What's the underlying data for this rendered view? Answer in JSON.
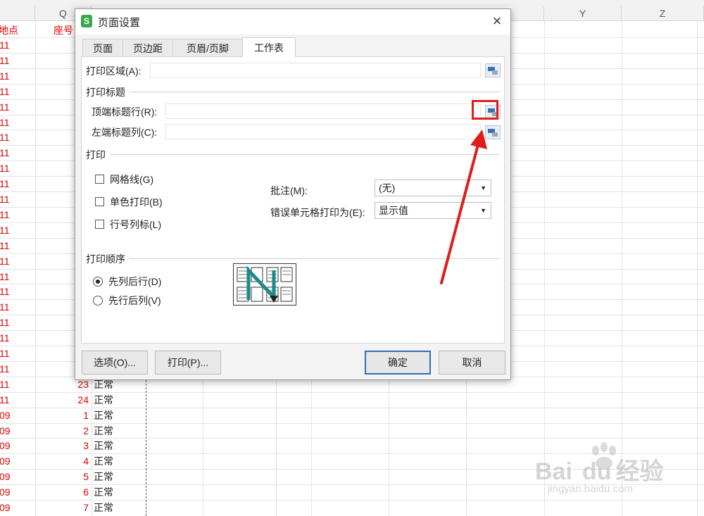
{
  "sheet": {
    "col_headers": [
      {
        "label": "Q"
      },
      {
        "label": "Y"
      },
      {
        "label": "Z"
      }
    ],
    "header_row": {
      "col_p_text": "地点",
      "col_q_text": "座号"
    },
    "rows": [
      {
        "p": "11",
        "q": "",
        "r": ""
      },
      {
        "p": "11",
        "q": "",
        "r": ""
      },
      {
        "p": "11",
        "q": "",
        "r": ""
      },
      {
        "p": "11",
        "q": "",
        "r": ""
      },
      {
        "p": "11",
        "q": "",
        "r": ""
      },
      {
        "p": "11",
        "q": "",
        "r": ""
      },
      {
        "p": "11",
        "q": "",
        "r": ""
      },
      {
        "p": "11",
        "q": "",
        "r": ""
      },
      {
        "p": "11",
        "q": "",
        "r": ""
      },
      {
        "p": "11",
        "q": "",
        "r": ""
      },
      {
        "p": "11",
        "q": "",
        "r": ""
      },
      {
        "p": "11",
        "q": "",
        "r": ""
      },
      {
        "p": "11",
        "q": "",
        "r": ""
      },
      {
        "p": "11",
        "q": "",
        "r": ""
      },
      {
        "p": "11",
        "q": "",
        "r": ""
      },
      {
        "p": "11",
        "q": "",
        "r": ""
      },
      {
        "p": "11",
        "q": "",
        "r": ""
      },
      {
        "p": "11",
        "q": "",
        "r": ""
      },
      {
        "p": "11",
        "q": "",
        "r": ""
      },
      {
        "p": "11",
        "q": "",
        "r": ""
      },
      {
        "p": "11",
        "q": "",
        "r": ""
      },
      {
        "p": "11",
        "q": "",
        "r": ""
      },
      {
        "p": "11",
        "q": "23",
        "r": "正常"
      },
      {
        "p": "11",
        "q": "24",
        "r": "正常"
      },
      {
        "p": "09",
        "q": "1",
        "r": "正常"
      },
      {
        "p": "09",
        "q": "2",
        "r": "正常"
      },
      {
        "p": "09",
        "q": "3",
        "r": "正常"
      },
      {
        "p": "09",
        "q": "4",
        "r": "正常"
      },
      {
        "p": "09",
        "q": "5",
        "r": "正常"
      },
      {
        "p": "09",
        "q": "6",
        "r": "正常"
      },
      {
        "p": "09",
        "q": "7",
        "r": "正常"
      }
    ]
  },
  "dialog": {
    "title": "页面设置",
    "app_icon_letter": "S",
    "close_glyph": "×",
    "tabs": [
      {
        "label": "页面",
        "active": false
      },
      {
        "label": "页边距",
        "active": false
      },
      {
        "label": "页眉/页脚",
        "active": false
      },
      {
        "label": "工作表",
        "active": true
      }
    ],
    "print_area": {
      "label": "打印区域(A):",
      "value": ""
    },
    "print_titles": {
      "section": "打印标题",
      "top_rows_label": "顶端标题行(R):",
      "top_rows_value": "",
      "left_cols_label": "左端标题列(C):",
      "left_cols_value": ""
    },
    "print": {
      "section": "打印",
      "gridlines": {
        "label": "网格线(G)",
        "checked": false
      },
      "mono": {
        "label": "单色打印(B)",
        "checked": false
      },
      "row_col_headers": {
        "label": "行号列标(L)",
        "checked": false
      },
      "comments_label": "批注(M):",
      "comments_value": "(无)",
      "errors_label": "错误单元格打印为(E):",
      "errors_value": "显示值"
    },
    "order": {
      "section": "打印顺序",
      "down_then_over": {
        "label": "先列后行(D)",
        "selected": true
      },
      "over_then_down": {
        "label": "先行后列(V)",
        "selected": false
      }
    },
    "buttons": {
      "options": "选项(O)...",
      "print": "打印(P)...",
      "ok": "确定",
      "cancel": "取消"
    }
  },
  "watermark": {
    "main": "Bai",
    "paw": "du",
    "cn": "经验",
    "url": "jingyan.baidu.com"
  },
  "colors": {
    "annotation_red": "#e21b1b",
    "sheet_red_text": "#e00000",
    "primary_button_border": "#2f6fb8"
  }
}
